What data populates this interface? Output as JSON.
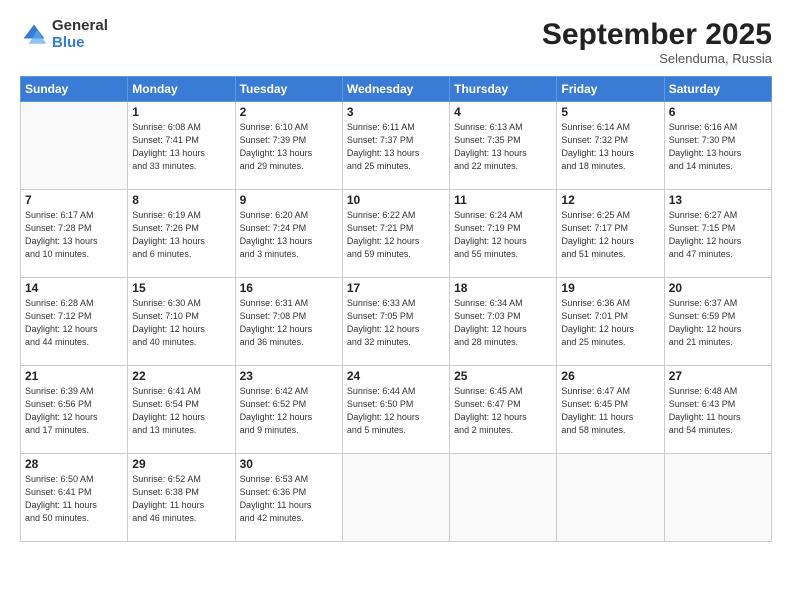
{
  "logo": {
    "general": "General",
    "blue": "Blue"
  },
  "title": "September 2025",
  "subtitle": "Selenduma, Russia",
  "days_header": [
    "Sunday",
    "Monday",
    "Tuesday",
    "Wednesday",
    "Thursday",
    "Friday",
    "Saturday"
  ],
  "weeks": [
    [
      {
        "day": "",
        "info": ""
      },
      {
        "day": "1",
        "info": "Sunrise: 6:08 AM\nSunset: 7:41 PM\nDaylight: 13 hours\nand 33 minutes."
      },
      {
        "day": "2",
        "info": "Sunrise: 6:10 AM\nSunset: 7:39 PM\nDaylight: 13 hours\nand 29 minutes."
      },
      {
        "day": "3",
        "info": "Sunrise: 6:11 AM\nSunset: 7:37 PM\nDaylight: 13 hours\nand 25 minutes."
      },
      {
        "day": "4",
        "info": "Sunrise: 6:13 AM\nSunset: 7:35 PM\nDaylight: 13 hours\nand 22 minutes."
      },
      {
        "day": "5",
        "info": "Sunrise: 6:14 AM\nSunset: 7:32 PM\nDaylight: 13 hours\nand 18 minutes."
      },
      {
        "day": "6",
        "info": "Sunrise: 6:16 AM\nSunset: 7:30 PM\nDaylight: 13 hours\nand 14 minutes."
      }
    ],
    [
      {
        "day": "7",
        "info": "Sunrise: 6:17 AM\nSunset: 7:28 PM\nDaylight: 13 hours\nand 10 minutes."
      },
      {
        "day": "8",
        "info": "Sunrise: 6:19 AM\nSunset: 7:26 PM\nDaylight: 13 hours\nand 6 minutes."
      },
      {
        "day": "9",
        "info": "Sunrise: 6:20 AM\nSunset: 7:24 PM\nDaylight: 13 hours\nand 3 minutes."
      },
      {
        "day": "10",
        "info": "Sunrise: 6:22 AM\nSunset: 7:21 PM\nDaylight: 12 hours\nand 59 minutes."
      },
      {
        "day": "11",
        "info": "Sunrise: 6:24 AM\nSunset: 7:19 PM\nDaylight: 12 hours\nand 55 minutes."
      },
      {
        "day": "12",
        "info": "Sunrise: 6:25 AM\nSunset: 7:17 PM\nDaylight: 12 hours\nand 51 minutes."
      },
      {
        "day": "13",
        "info": "Sunrise: 6:27 AM\nSunset: 7:15 PM\nDaylight: 12 hours\nand 47 minutes."
      }
    ],
    [
      {
        "day": "14",
        "info": "Sunrise: 6:28 AM\nSunset: 7:12 PM\nDaylight: 12 hours\nand 44 minutes."
      },
      {
        "day": "15",
        "info": "Sunrise: 6:30 AM\nSunset: 7:10 PM\nDaylight: 12 hours\nand 40 minutes."
      },
      {
        "day": "16",
        "info": "Sunrise: 6:31 AM\nSunset: 7:08 PM\nDaylight: 12 hours\nand 36 minutes."
      },
      {
        "day": "17",
        "info": "Sunrise: 6:33 AM\nSunset: 7:05 PM\nDaylight: 12 hours\nand 32 minutes."
      },
      {
        "day": "18",
        "info": "Sunrise: 6:34 AM\nSunset: 7:03 PM\nDaylight: 12 hours\nand 28 minutes."
      },
      {
        "day": "19",
        "info": "Sunrise: 6:36 AM\nSunset: 7:01 PM\nDaylight: 12 hours\nand 25 minutes."
      },
      {
        "day": "20",
        "info": "Sunrise: 6:37 AM\nSunset: 6:59 PM\nDaylight: 12 hours\nand 21 minutes."
      }
    ],
    [
      {
        "day": "21",
        "info": "Sunrise: 6:39 AM\nSunset: 6:56 PM\nDaylight: 12 hours\nand 17 minutes."
      },
      {
        "day": "22",
        "info": "Sunrise: 6:41 AM\nSunset: 6:54 PM\nDaylight: 12 hours\nand 13 minutes."
      },
      {
        "day": "23",
        "info": "Sunrise: 6:42 AM\nSunset: 6:52 PM\nDaylight: 12 hours\nand 9 minutes."
      },
      {
        "day": "24",
        "info": "Sunrise: 6:44 AM\nSunset: 6:50 PM\nDaylight: 12 hours\nand 5 minutes."
      },
      {
        "day": "25",
        "info": "Sunrise: 6:45 AM\nSunset: 6:47 PM\nDaylight: 12 hours\nand 2 minutes."
      },
      {
        "day": "26",
        "info": "Sunrise: 6:47 AM\nSunset: 6:45 PM\nDaylight: 11 hours\nand 58 minutes."
      },
      {
        "day": "27",
        "info": "Sunrise: 6:48 AM\nSunset: 6:43 PM\nDaylight: 11 hours\nand 54 minutes."
      }
    ],
    [
      {
        "day": "28",
        "info": "Sunrise: 6:50 AM\nSunset: 6:41 PM\nDaylight: 11 hours\nand 50 minutes."
      },
      {
        "day": "29",
        "info": "Sunrise: 6:52 AM\nSunset: 6:38 PM\nDaylight: 11 hours\nand 46 minutes."
      },
      {
        "day": "30",
        "info": "Sunrise: 6:53 AM\nSunset: 6:36 PM\nDaylight: 11 hours\nand 42 minutes."
      },
      {
        "day": "",
        "info": ""
      },
      {
        "day": "",
        "info": ""
      },
      {
        "day": "",
        "info": ""
      },
      {
        "day": "",
        "info": ""
      }
    ]
  ]
}
